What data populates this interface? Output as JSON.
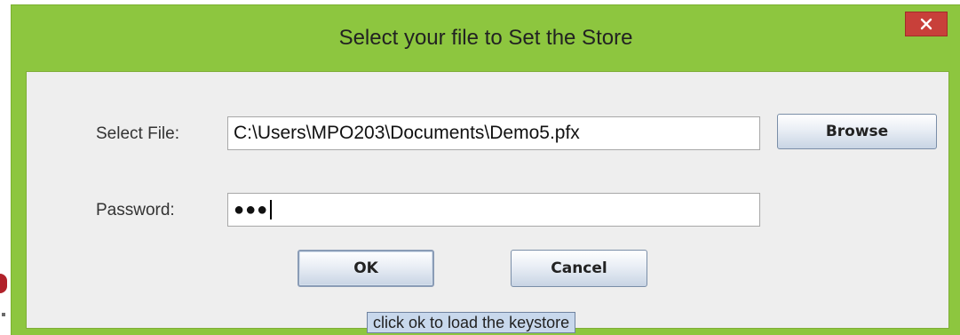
{
  "window": {
    "title": "Select your file to Set the Store",
    "close_glyph": "✕"
  },
  "form": {
    "file_label": "Select File:",
    "file_value": "C:\\Users\\MPO203\\Documents\\Demo5.pfx",
    "password_label": "Password:",
    "password_masked": "●●●"
  },
  "buttons": {
    "browse": "Browse",
    "ok": "OK",
    "cancel": "Cancel"
  },
  "tooltip": {
    "text": "click ok to load the keystore"
  },
  "colors": {
    "frame": "#8dc63f",
    "close": "#c8403a",
    "client": "#eeeeee",
    "tooltip": "#c8d8ec"
  },
  "icons": {
    "close": "close-icon"
  }
}
